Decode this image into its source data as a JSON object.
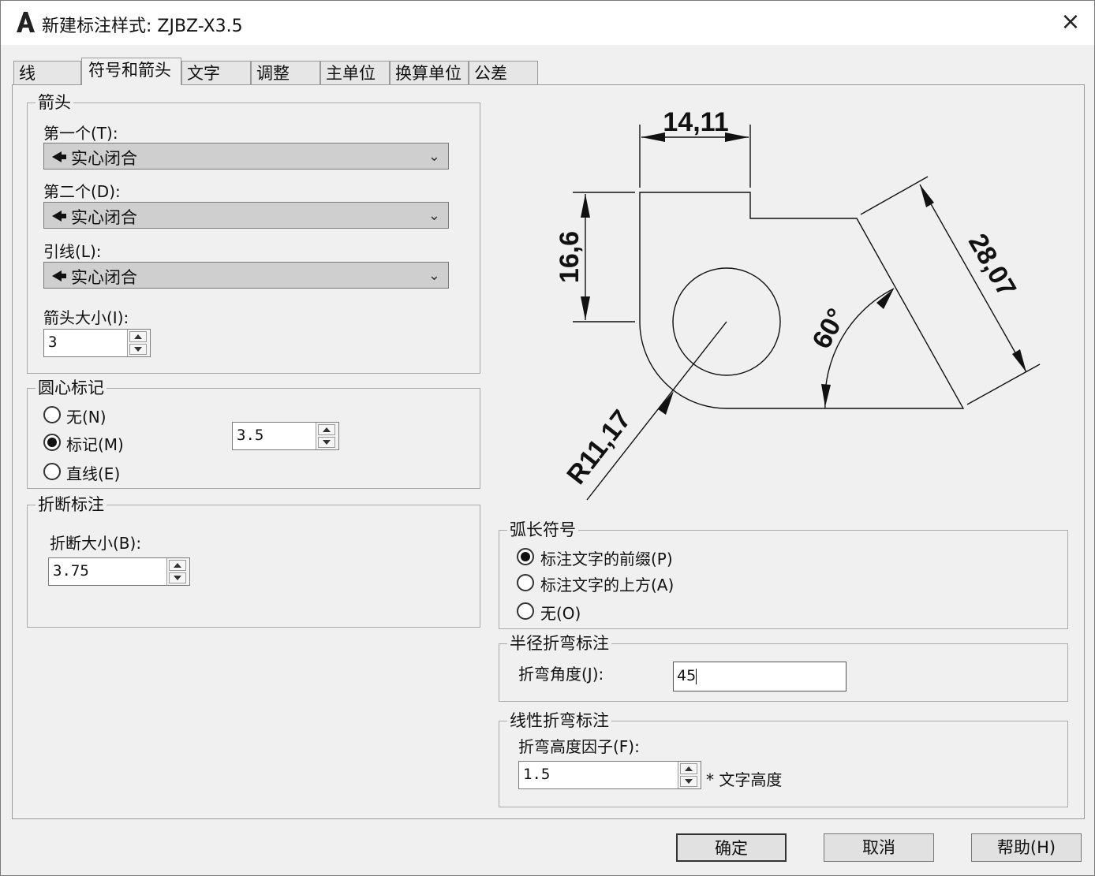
{
  "window": {
    "title": "新建标注样式: ZJBZ-X3.5",
    "close_icon": "×"
  },
  "tabs": [
    {
      "label": "线"
    },
    {
      "label": "符号和箭头",
      "active": true
    },
    {
      "label": "文字"
    },
    {
      "label": "调整"
    },
    {
      "label": "主单位"
    },
    {
      "label": "换算单位"
    },
    {
      "label": "公差"
    }
  ],
  "arrows": {
    "legend": "箭头",
    "first_label": "第一个(T):",
    "first_value": "实心闭合",
    "second_label": "第二个(D):",
    "second_value": "实心闭合",
    "leader_label": "引线(L):",
    "leader_value": "实心闭合",
    "size_label": "箭头大小(I):",
    "size_value": "3"
  },
  "center_marks": {
    "legend": "圆心标记",
    "options": [
      "无(N)",
      "标记(M)",
      "直线(E)"
    ],
    "selected": "标记(M)",
    "size_value": "3.5"
  },
  "break": {
    "legend": "折断标注",
    "size_label": "折断大小(B):",
    "size_value": "3.75"
  },
  "preview": {
    "dim_top": "14,11",
    "dim_left": "16,6",
    "dim_slant": "28,07",
    "dim_angle": "60°",
    "dim_radius": "R11,17"
  },
  "arc_length": {
    "legend": "弧长符号",
    "options": [
      "标注文字的前缀(P)",
      "标注文字的上方(A)",
      "无(O)"
    ],
    "selected": "标注文字的前缀(P)"
  },
  "radius_jog": {
    "legend": "半径折弯标注",
    "angle_label": "折弯角度(J):",
    "angle_value": "45"
  },
  "linear_jog": {
    "legend": "线性折弯标注",
    "factor_label": "折弯高度因子(F):",
    "factor_value": "1.5",
    "suffix": "* 文字高度"
  },
  "buttons": {
    "ok": "确定",
    "cancel": "取消",
    "help": "帮助(H)"
  }
}
